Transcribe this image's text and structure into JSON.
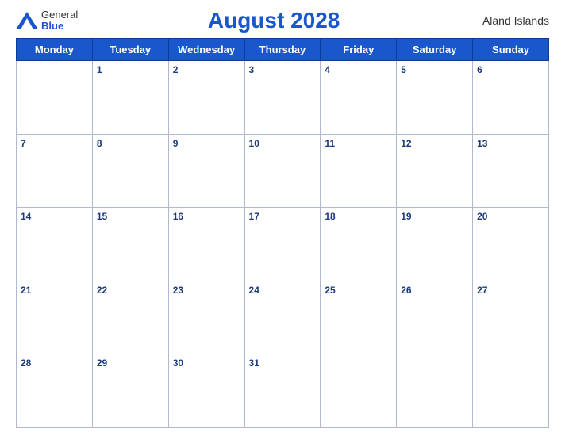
{
  "header": {
    "logo_general": "General",
    "logo_blue": "Blue",
    "title": "August 2028",
    "region": "Aland Islands"
  },
  "weekdays": [
    "Monday",
    "Tuesday",
    "Wednesday",
    "Thursday",
    "Friday",
    "Saturday",
    "Sunday"
  ],
  "weeks": [
    [
      null,
      1,
      2,
      3,
      4,
      5,
      6
    ],
    [
      7,
      8,
      9,
      10,
      11,
      12,
      13
    ],
    [
      14,
      15,
      16,
      17,
      18,
      19,
      20
    ],
    [
      21,
      22,
      23,
      24,
      25,
      26,
      27
    ],
    [
      28,
      29,
      30,
      31,
      null,
      null,
      null
    ]
  ]
}
